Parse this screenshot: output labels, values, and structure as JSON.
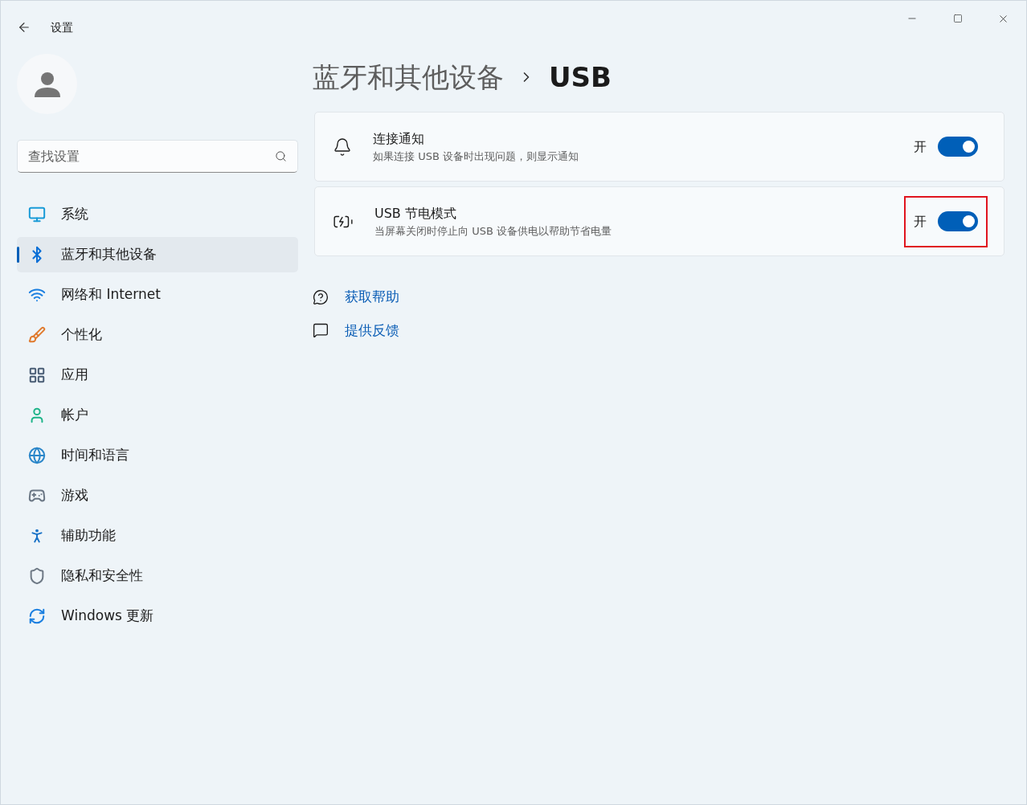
{
  "window": {
    "title": "设置"
  },
  "sidebar": {
    "search": {
      "placeholder": "查找设置"
    },
    "items": [
      {
        "label": "系统",
        "selected": false
      },
      {
        "label": "蓝牙和其他设备",
        "selected": true
      },
      {
        "label": "网络和 Internet",
        "selected": false
      },
      {
        "label": "个性化",
        "selected": false
      },
      {
        "label": "应用",
        "selected": false
      },
      {
        "label": "帐户",
        "selected": false
      },
      {
        "label": "时间和语言",
        "selected": false
      },
      {
        "label": "游戏",
        "selected": false
      },
      {
        "label": "辅助功能",
        "selected": false
      },
      {
        "label": "隐私和安全性",
        "selected": false
      },
      {
        "label": "Windows 更新",
        "selected": false
      }
    ]
  },
  "breadcrumb": {
    "parent": "蓝牙和其他设备",
    "current": "USB"
  },
  "settings": [
    {
      "title": "连接通知",
      "description": "如果连接 USB 设备时出现问题，则显示通知",
      "state_label": "开",
      "on": true,
      "highlighted": false
    },
    {
      "title": "USB 节电模式",
      "description": "当屏幕关闭时停止向 USB 设备供电以帮助节省电量",
      "state_label": "开",
      "on": true,
      "highlighted": true
    }
  ],
  "links": [
    "获取帮助",
    "提供反馈"
  ]
}
